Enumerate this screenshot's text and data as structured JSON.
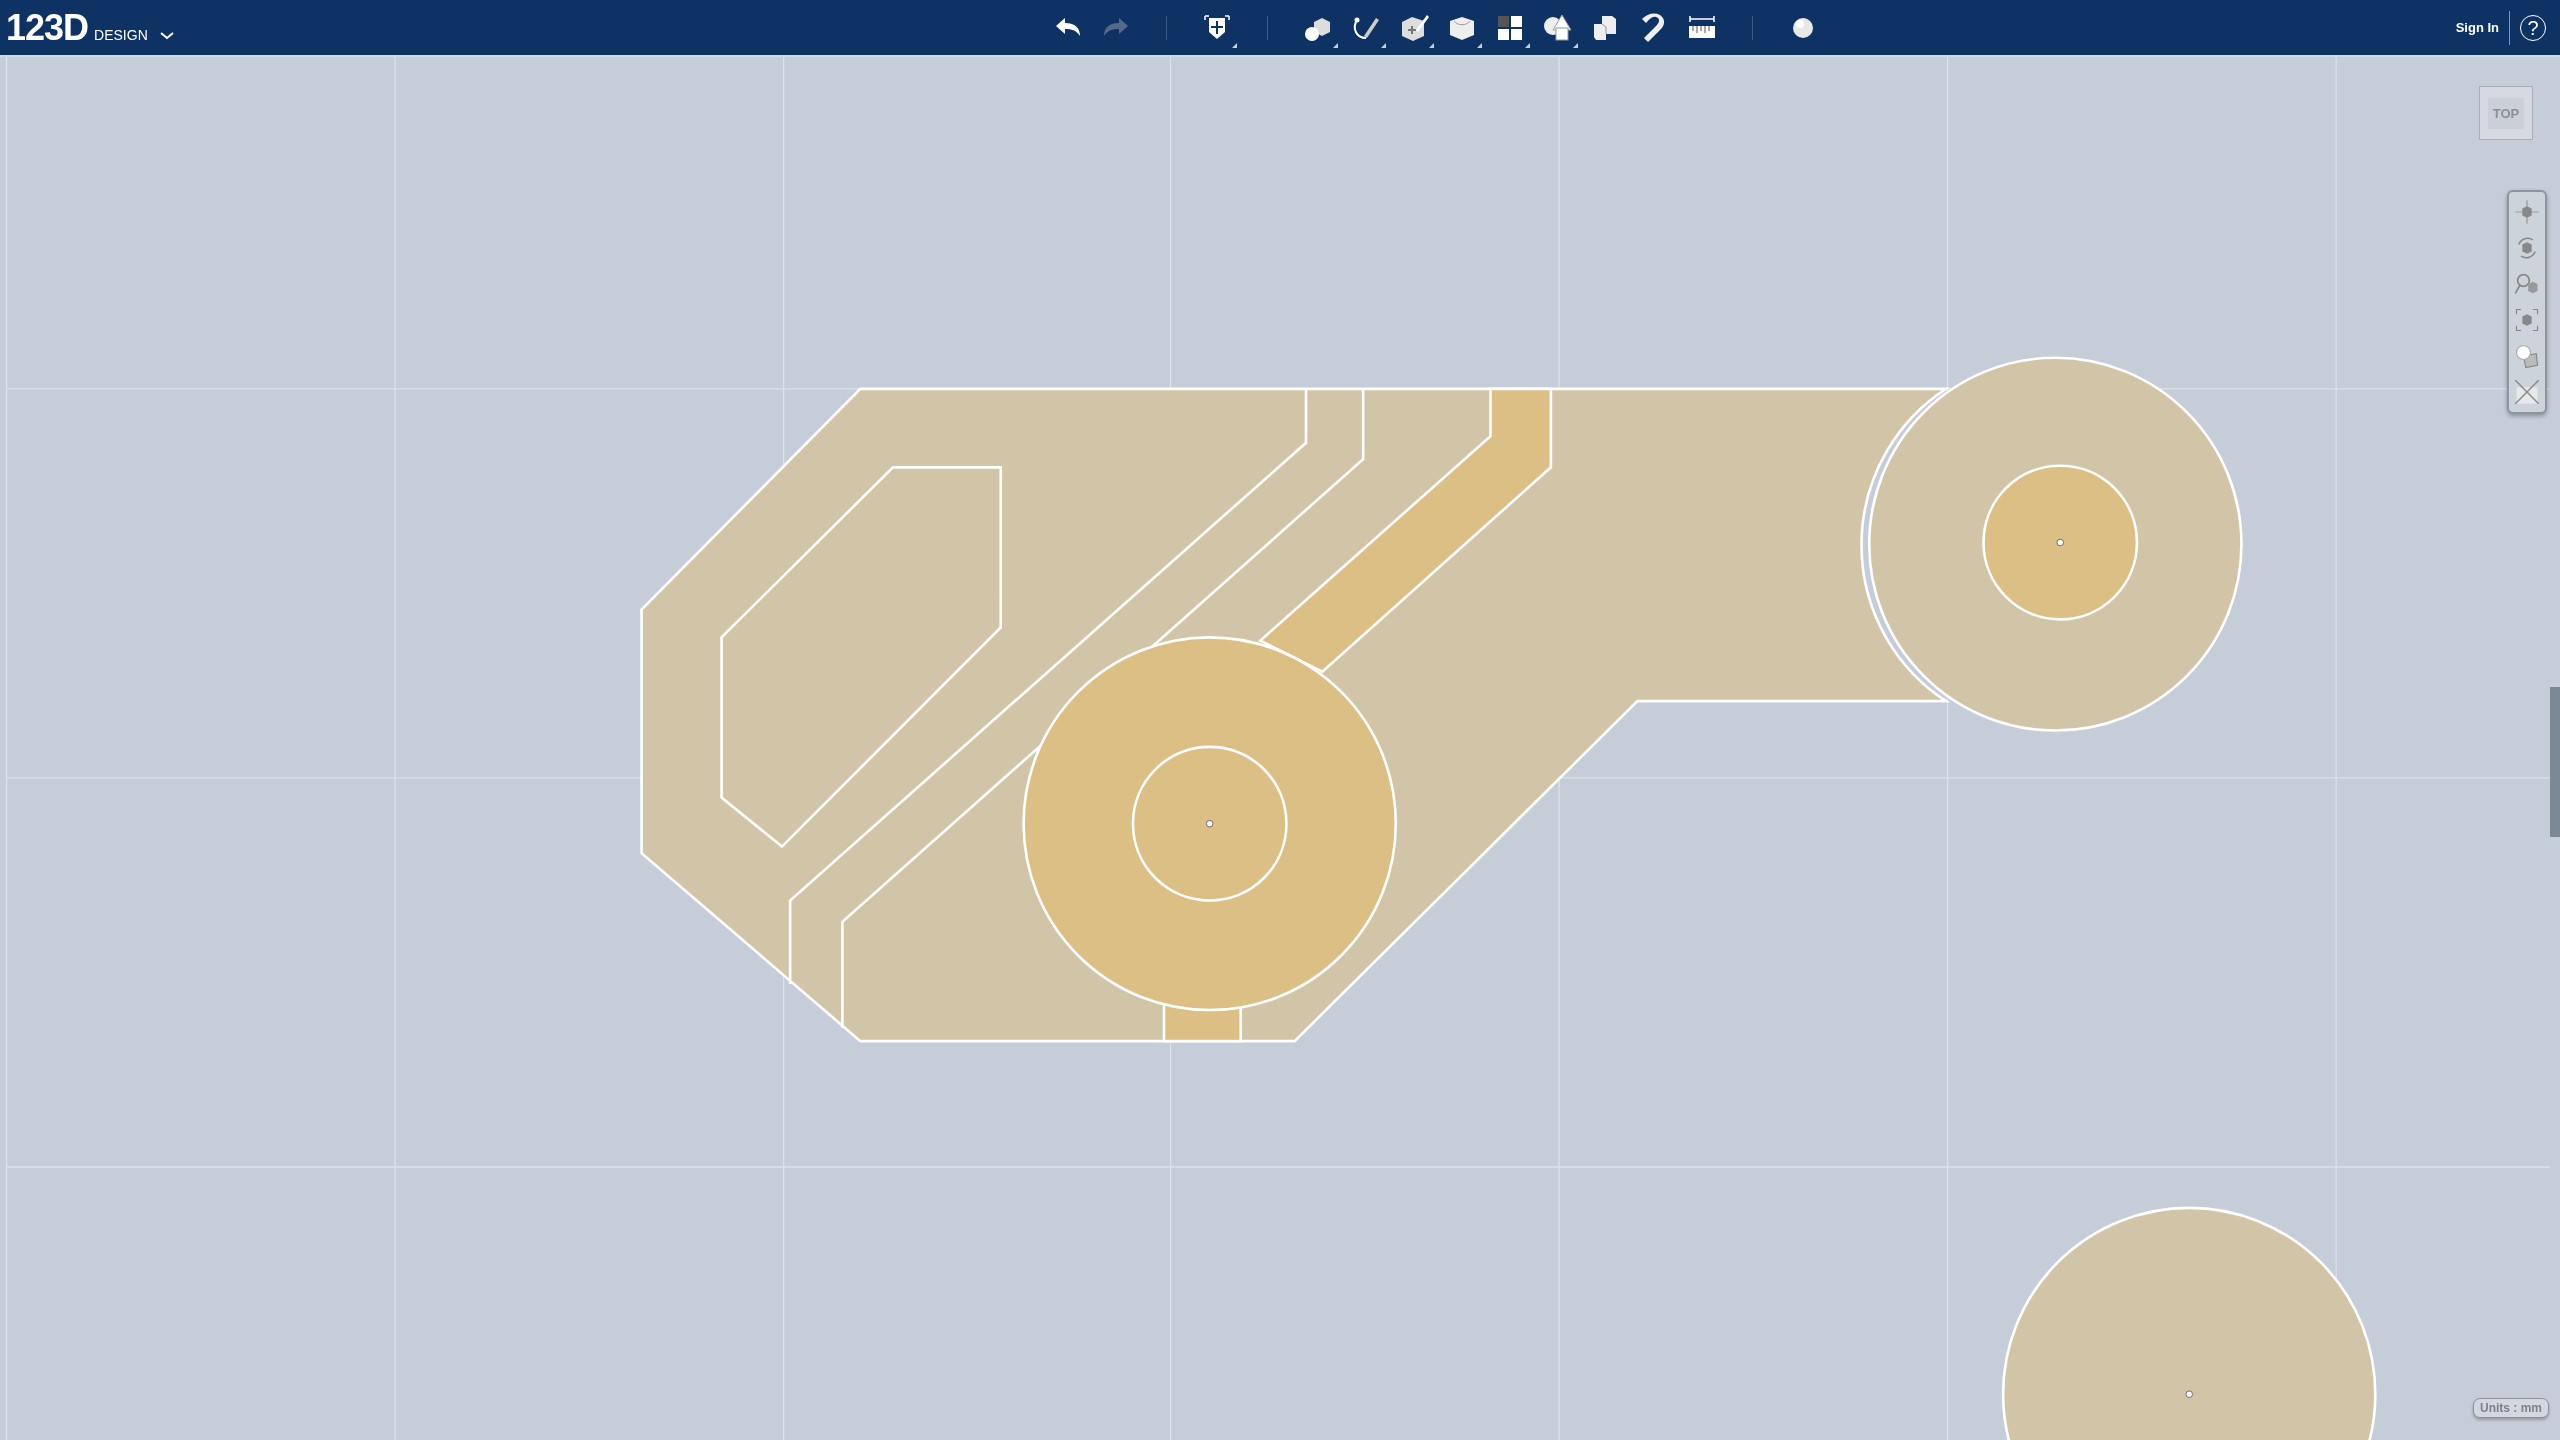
{
  "app": {
    "logo": "123D",
    "product": "DESIGN"
  },
  "toolbar": [
    {
      "kind": "undo",
      "disabled": false,
      "has_menu": false
    },
    {
      "kind": "redo",
      "disabled": true,
      "has_menu": false
    },
    {
      "kind": "transform",
      "disabled": false,
      "has_menu": true
    },
    {
      "kind": "primitives",
      "disabled": false,
      "has_menu": true
    },
    {
      "kind": "sketch",
      "disabled": false,
      "has_menu": true
    },
    {
      "kind": "construct",
      "disabled": false,
      "has_menu": true
    },
    {
      "kind": "modify",
      "disabled": false,
      "has_menu": true
    },
    {
      "kind": "pattern",
      "disabled": false,
      "has_menu": true
    },
    {
      "kind": "grouping",
      "disabled": false,
      "has_menu": true
    },
    {
      "kind": "combine",
      "disabled": false,
      "has_menu": false
    },
    {
      "kind": "snap",
      "disabled": false,
      "has_menu": false
    },
    {
      "kind": "measure",
      "disabled": false,
      "has_menu": false
    },
    {
      "kind": "material",
      "disabled": false,
      "has_menu": false
    }
  ],
  "account": {
    "sign_in": "Sign In",
    "help": "?"
  },
  "view_cube": {
    "label": "TOP"
  },
  "status": {
    "units": "Units : mm"
  }
}
